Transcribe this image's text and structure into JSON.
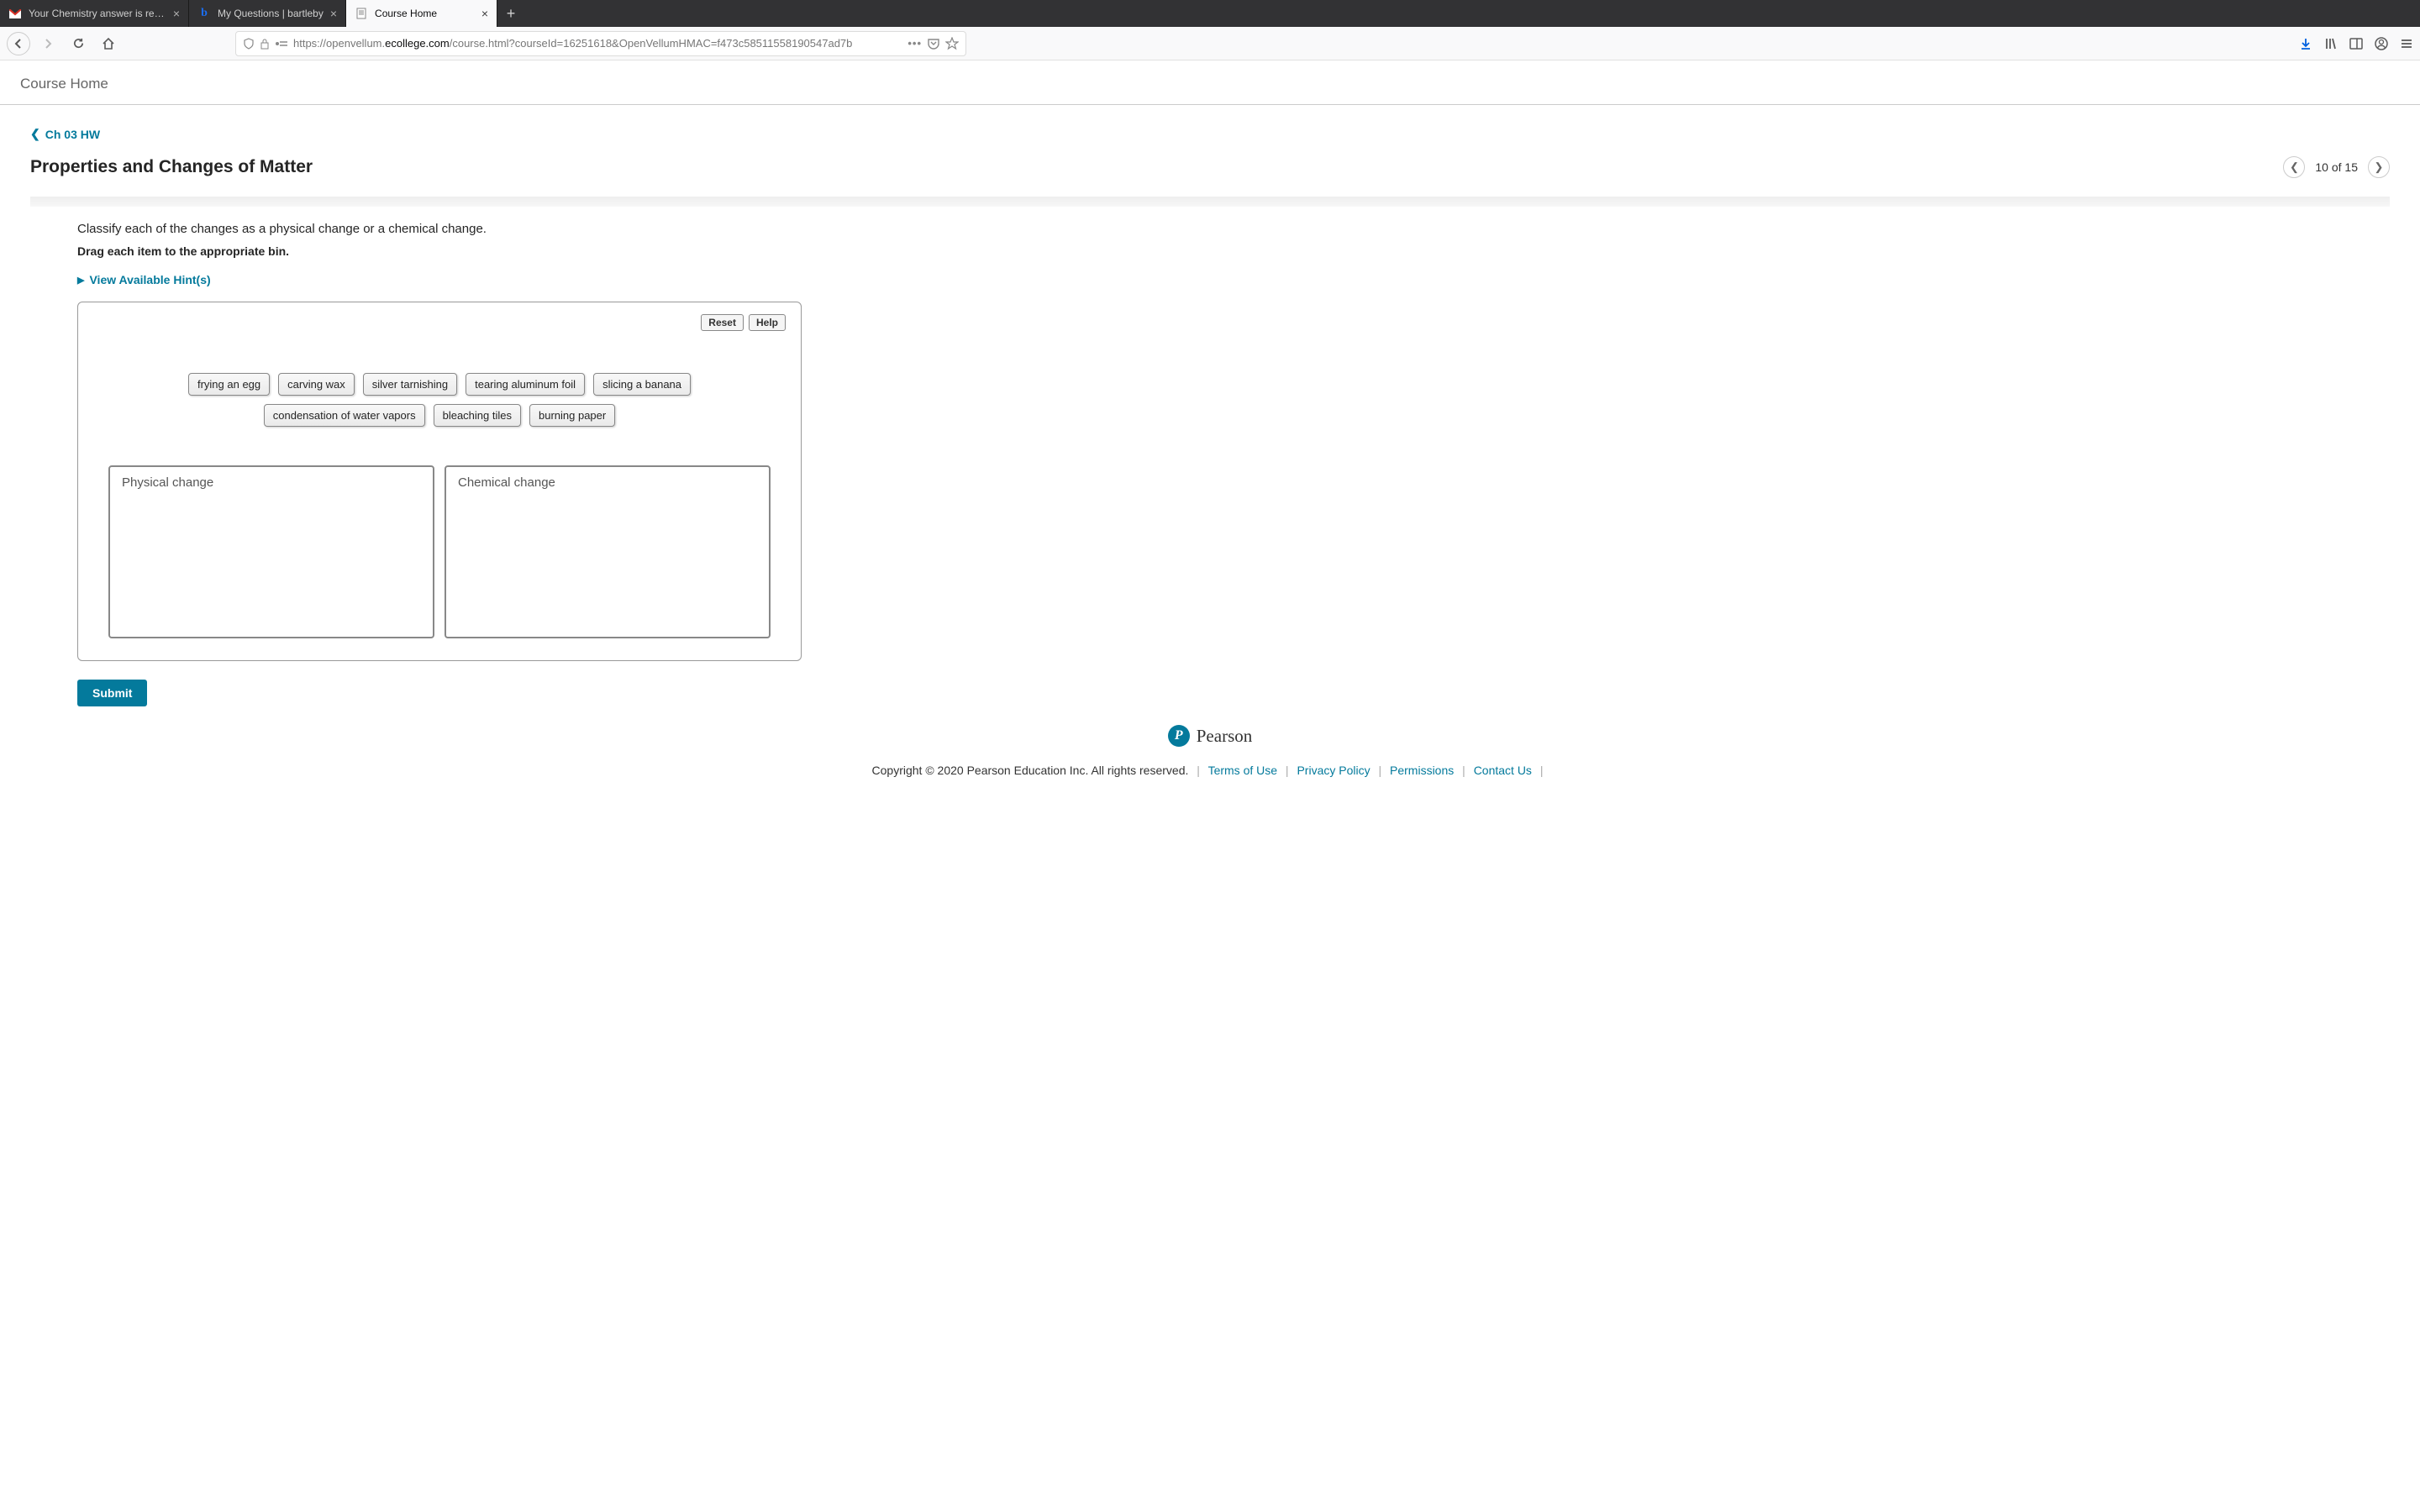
{
  "browser": {
    "tabs": [
      {
        "title": "Your Chemistry answer is ready",
        "favicon": "gmail"
      },
      {
        "title": "My Questions | bartleby",
        "favicon": "bartleby"
      },
      {
        "title": "Course Home",
        "favicon": "page"
      }
    ],
    "url_prefix": "https://openvellum.",
    "url_domain": "ecollege.com",
    "url_path": "/course.html?courseId=16251618&OpenVellumHMAC=f473c58511558190547ad7b"
  },
  "page": {
    "header_title": "Course Home",
    "breadcrumb": "Ch 03 HW",
    "question_title": "Properties and Changes of Matter",
    "pager_text": "10 of 15",
    "question_text": "Classify each of the changes as a physical change or a chemical change.",
    "instruction": "Drag each item to the appropriate bin.",
    "hints_label": "View Available Hint(s)",
    "reset_label": "Reset",
    "help_label": "Help",
    "chips": [
      "frying an egg",
      "carving wax",
      "silver tarnishing",
      "tearing aluminum foil",
      "slicing a banana",
      "condensation of water vapors",
      "bleaching tiles",
      "burning paper"
    ],
    "bin_physical": "Physical change",
    "bin_chemical": "Chemical change",
    "submit_label": "Submit",
    "brand": "Pearson",
    "copyright": "Copyright © 2020 Pearson Education Inc. All rights reserved.",
    "footer_links": [
      "Terms of Use",
      "Privacy Policy",
      "Permissions",
      "Contact Us"
    ]
  }
}
